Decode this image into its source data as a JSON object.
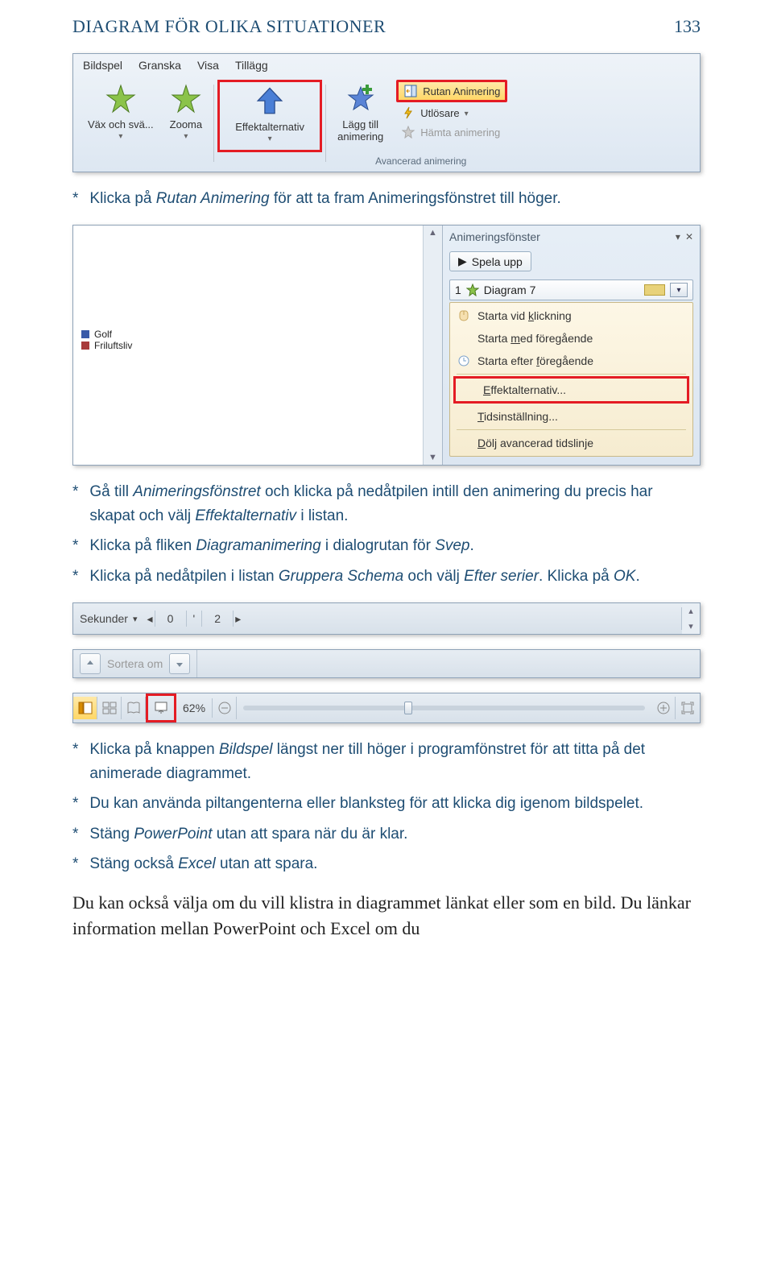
{
  "header": {
    "title": "DIAGRAM FÖR OLIKA SITUATIONER",
    "page": "133"
  },
  "ribbon": {
    "tabs": [
      "Bildspel",
      "Granska",
      "Visa",
      "Tillägg"
    ],
    "btn1": "Väx och svä...",
    "btn2": "Zooma",
    "btn3": "Effektalternativ",
    "btn4": "Lägg till\nanimering",
    "side": {
      "a": "Rutan Animering",
      "b": "Utlösare",
      "c": "Hämta animering"
    },
    "group": "Avancerad animering"
  },
  "bul1": [
    {
      "pre": "Klicka på ",
      "i": "Rutan Animering",
      "post": " för att ta fram Animeringsfönstret till höger."
    }
  ],
  "panel": {
    "title": "Animeringsfönster",
    "play": "Spela upp",
    "item": {
      "n": "1",
      "label": "Diagram 7"
    },
    "menu": {
      "a": "Starta vid klickning",
      "b": "Starta med föregående",
      "c": "Starta efter föregående",
      "d": "Effektalternativ...",
      "e": "Tidsinställning...",
      "f": "Dölj avancerad tidslinje"
    },
    "legend": {
      "a": "Golf",
      "b": "Friluftsliv"
    }
  },
  "bul2": [
    {
      "pre": "Gå till ",
      "i": "Animeringsfönstret",
      "post": " och klicka på nedåtpilen intill den animering du precis har skapat och välj ",
      "i2": "Effektalternativ",
      "post2": " i listan."
    },
    {
      "pre": "Klicka på fliken ",
      "i": "Diagramanimering",
      "post": " i dialogrutan för ",
      "i2": "Svep",
      "post2": "."
    },
    {
      "pre": "Klicka på nedåtpilen i listan ",
      "i": "Gruppera Schema",
      "post": " och välj ",
      "i2": "Efter serier",
      "post2": ". Klicka på ",
      "i3": "OK",
      "post3": "."
    }
  ],
  "status": {
    "sek": "Sekunder",
    "v0": "0",
    "v2": "2",
    "sort": "Sortera om",
    "zoom": "62%"
  },
  "bul3": [
    {
      "pre": "Klicka på knappen ",
      "i": "Bildspel",
      "post": " längst ner till höger i programfönstret för att titta på det animerade diagrammet."
    },
    {
      "pre": "Du kan använda piltangenterna eller blanksteg för att klicka dig igenom bildspelet."
    },
    {
      "pre": "Stäng ",
      "i": "PowerPoint",
      "post": " utan att spara när du är klar."
    },
    {
      "pre": "Stäng också ",
      "i": "Excel",
      "post": " utan att spara."
    }
  ],
  "body": "Du kan också välja om du vill klistra in diagrammet länkat eller som en bild. Du länkar information mellan PowerPoint och Excel om du"
}
